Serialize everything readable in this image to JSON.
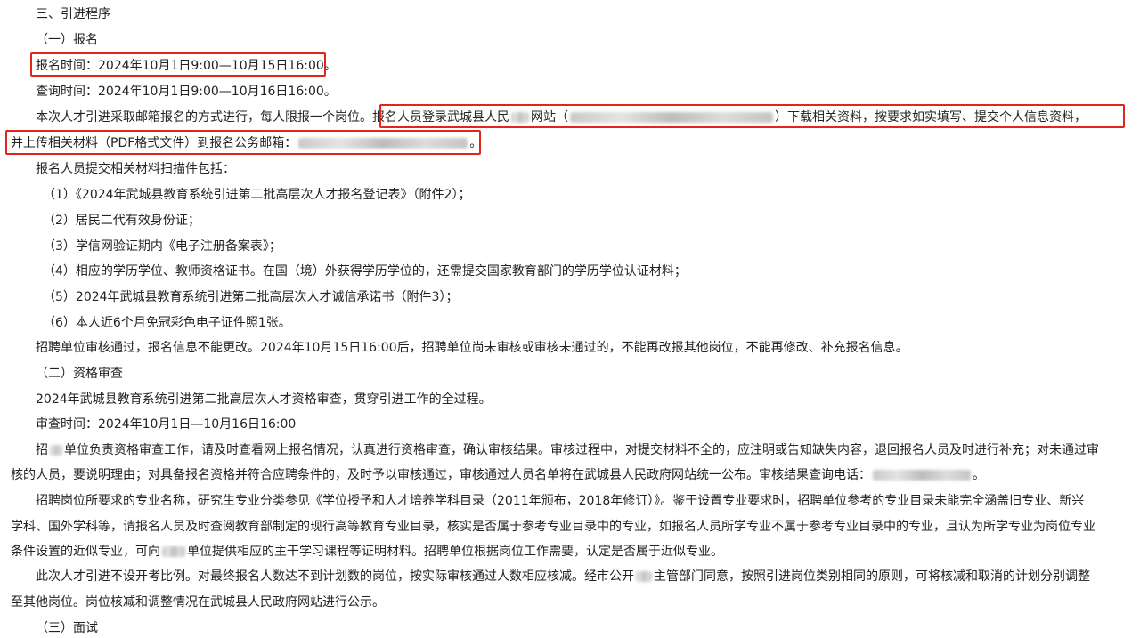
{
  "section_heading": "三、引进程序",
  "sub1": "（一）报名",
  "reg_time": "报名时间：2024年10月1日9:00—10月15日16:00。",
  "query_time": "查询时间：2024年10月1日9:00—10月16日16:00。",
  "p1_a": "本次人才引进采取邮箱报名的方式进行，每人限报一个岗位。",
  "p1_b": "报名人员登录武城县人民",
  "p1_c": "网站（",
  "p1_d": "）下载相关资料，按要求如实填写、提交个人信息资料，",
  "p1_e": "并上传相关材料（PDF格式文件）到报名公务邮箱：",
  "p1_f": "。",
  "materials_intro": "报名人员提交相关材料扫描件包括：",
  "materials": [
    "（1）《2024年武城县教育系统引进第二批高层次人才报名登记表》（附件2）；",
    "（2）居民二代有效身份证；",
    "（3）学信网验证期内《电子注册备案表》；",
    "（4）相应的学历学位、教师资格证书。在国（境）外获得学历学位的，还需提交国家教育部门的学历学位认证材料；",
    "（5）2024年武城县教育系统引进第二批高层次人才诚信承诺书（附件3）；",
    "（6）本人近6个月免冠彩色电子证件照1张。"
  ],
  "review_note": "招聘单位审核通过，报名信息不能更改。2024年10月15日16:00后，招聘单位尚未审核或审核未通过的，不能再改报其他岗位，不能再修改、补充报名信息。",
  "sub2": "（二）资格审查",
  "qual_desc": "2024年武城县教育系统引进第二批高层次人才资格审查，贯穿引进工作的全过程。",
  "qual_time": "审查时间：2024年10月1日—10月16日16:00",
  "p2_a": "招",
  "p2_b": "单位负责资格审查工作，请及时查看网上报名情况，认真进行资格审查，确认审核结果。审核过程中，对提交材料不全的，应注明或告知缺失内容，退回报名人员及时进行补充；对未通过审",
  "p2_c": "核的人员，要说明理由；对具备报名资格并符合应聘条件的，及时予以审核通过，审核通过人员名单将在武城县人民政府网站统一公布。审核结果查询电话：",
  "p2_d": "。",
  "p3_line1": "招聘岗位所要求的专业名称，研究生专业分类参见《学位授予和人才培养学科目录（2011年颁布，2018年修订）》。鉴于设置专业要求时，招聘单位参考的专业目录未能完全涵盖旧专业、新兴",
  "p3_line2": "学科、国外学科等，请报名人员及时查阅教育部制定的现行高等教育专业目录，核实是否属于参考专业目录中的专业，如报名人员所学专业不属于参考专业目录中的专业，且认为所学专业为岗位专业",
  "p3_line3a": "条件设置的近似专业，可向",
  "p3_line3b": "单位提供相应的主干学习课程等证明材料。招聘单位根据岗位工作需要，认定是否属于近似专业。",
  "p4_line1a": "此次人才引进不设开考比例。对最终报名人数达不到计划数的岗位，按实际审核通过人数相应核减。经市公开",
  "p4_line1b": "主管部门同意，按照引进岗位类别相同的原则，可将核减和取消的计划分别调整",
  "p4_line2": "至其他岗位。岗位核减和调整情况在武城县人民政府网站进行公示。",
  "sub3": "（三）面试",
  "colors": {
    "text": "#222222",
    "highlight_box": "#e1251b",
    "redaction": "#c9c9c9"
  }
}
